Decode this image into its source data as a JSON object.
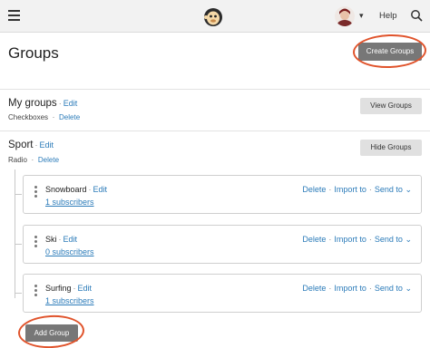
{
  "topbar": {
    "menu_icon": "hamburger-icon",
    "logo_icon": "mailchimp-logo",
    "avatar_icon": "user-avatar",
    "caret_icon": "chevron-down-icon",
    "help_label": "Help",
    "search_icon": "search-icon"
  },
  "page": {
    "title": "Groups",
    "create_button": "Create Groups"
  },
  "groups": [
    {
      "name": "My groups",
      "edit": "Edit",
      "type": "Checkboxes",
      "delete": "Delete",
      "toggle_button": "View Groups"
    },
    {
      "name": "Sport",
      "edit": "Edit",
      "type": "Radio",
      "delete": "Delete",
      "toggle_button": "Hide Groups",
      "items": [
        {
          "name": "Snowboard",
          "edit": "Edit",
          "subscribers": "1 subscribers",
          "delete": "Delete",
          "import": "Import to",
          "send": "Send to"
        },
        {
          "name": "Ski",
          "edit": "Edit",
          "subscribers": "0 subscribers",
          "delete": "Delete",
          "import": "Import to",
          "send": "Send to"
        },
        {
          "name": "Surfing",
          "edit": "Edit",
          "subscribers": "1 subscribers",
          "delete": "Delete",
          "import": "Import to",
          "send": "Send to"
        }
      ],
      "add_button": "Add Group"
    }
  ],
  "colors": {
    "accent_link": "#2b7bb9",
    "primary_button": "#777777",
    "annotation_ring": "#e0532b"
  }
}
